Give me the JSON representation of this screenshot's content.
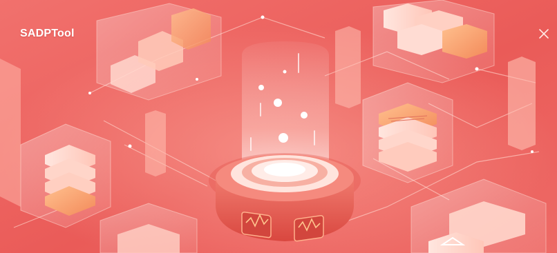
{
  "window": {
    "title": "SADPTool",
    "close_icon": "close-icon"
  },
  "colors": {
    "background": "#ec5f5c",
    "accent_light": "#ffd9d2",
    "accent_orange": "#f6a06a",
    "white": "#ffffff"
  }
}
